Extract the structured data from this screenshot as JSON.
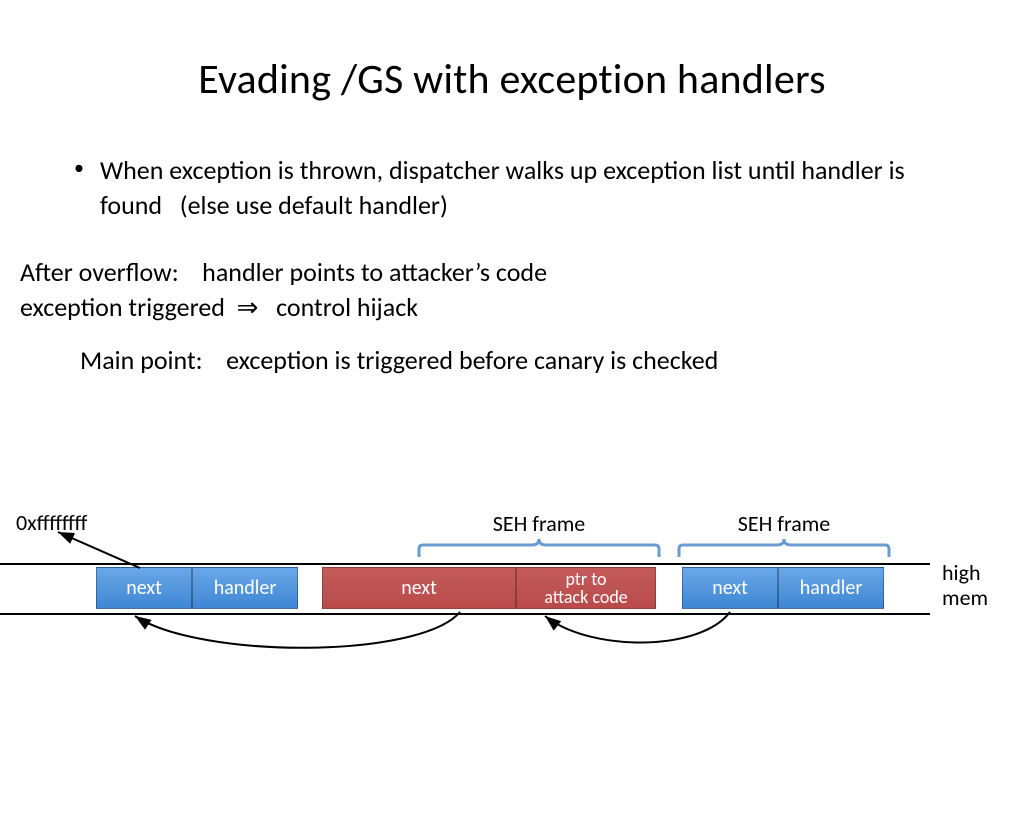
{
  "title": "Evading /GS with exception handlers",
  "bullet": "When exception is thrown, dispatcher walks up exception list until handler is found   (else use default handler)",
  "after_overflow_1": "After overflow:    handler points to attacker’s code",
  "after_overflow_2": "exception triggered  ⇒   control hijack",
  "main_point": "Main point:    exception is triggered before canary is checked",
  "hex_label": "0xffffffff",
  "seh_label_1": "SEH frame",
  "seh_label_2": "SEH frame",
  "frames": {
    "f1_next": "next",
    "f1_handler": "handler",
    "f2_next": "next",
    "f2_ptr_line1": "ptr to",
    "f2_ptr_line2": "attack code",
    "f3_next": "next",
    "f3_handler": "handler"
  },
  "high_mem_1": "high",
  "high_mem_2": "mem",
  "colors": {
    "blue": "#4a8fd8",
    "red": "#bd5151",
    "brace": "#6a9bd1"
  }
}
